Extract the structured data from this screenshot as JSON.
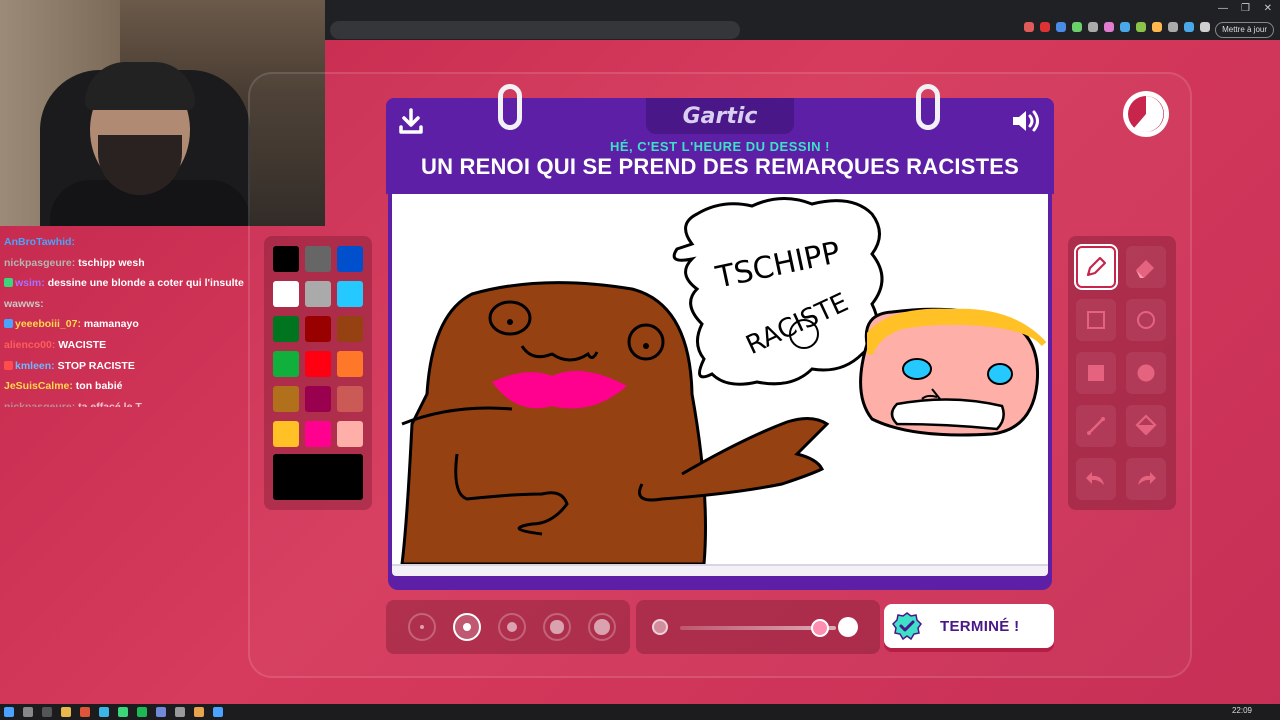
{
  "browser": {
    "update_button": "Mettre à jour",
    "extension_colors": [
      "#e05a5a",
      "#d33",
      "#4a8be8",
      "#6bd06b",
      "#aaa",
      "#e07cd0",
      "#4aa8e8",
      "#8bc34a",
      "#ffb84d",
      "#aaa",
      "#4aa8e8",
      "#cfcfcf"
    ]
  },
  "chat": {
    "messages": [
      {
        "user": "AnBroTawhid:",
        "user_color": "#4aa3ff",
        "msg": "",
        "badge": ""
      },
      {
        "user": "nickpasgeure:",
        "user_color": "#b5b5b5",
        "msg": "tschipp wesh",
        "badge": ""
      },
      {
        "user": "wsim:",
        "user_color": "#a970ff",
        "msg": "dessine une blonde a coter qui l'insulte",
        "badge": "#3bd67a"
      },
      {
        "user": "wawws:",
        "user_color": "#c9c9c9",
        "msg": "",
        "badge": ""
      },
      {
        "user": "yeeeboiii_07:",
        "user_color": "#ffd84d",
        "msg": "mamanayo",
        "badge": "#4aa3ff"
      },
      {
        "user": "alienco00:",
        "user_color": "#ff5d5d",
        "msg": "WACISTE",
        "badge": ""
      },
      {
        "user": "kmleen:",
        "user_color": "#6fb8ff",
        "msg": "STOP RACISTE",
        "badge": "#ff4d4d"
      },
      {
        "user": "JeSuisCalme:",
        "user_color": "#ffd84d",
        "msg": "ton babié",
        "badge": ""
      },
      {
        "user": "nickpasgeure:",
        "user_color": "#b5b5b5",
        "msg": "ta effacé le T",
        "badge": ""
      }
    ]
  },
  "game": {
    "logo": "Gartic",
    "subtitle": "HÉ, C'EST L'HEURE DU DESSIN !",
    "prompt": "UN RENOI QUI SE PREND DES REMARQUES RACISTES",
    "done_label": "TERMINÉ !",
    "selected_color": "#000000",
    "selected_size_index": 1,
    "opacity": 0.9,
    "palette": [
      "#000000",
      "#666666",
      "#0050cd",
      "#ffffff",
      "#aaaaaa",
      "#26c9ff",
      "#017420",
      "#990000",
      "#964112",
      "#11b03c",
      "#ff0013",
      "#ff7829",
      "#b0701c",
      "#99004e",
      "#cb5a57",
      "#ffc126",
      "#ff008f",
      "#feafa8"
    ],
    "tools": [
      {
        "name": "pencil",
        "active": true
      },
      {
        "name": "eraser",
        "active": false
      },
      {
        "name": "rectangle-outline",
        "active": false
      },
      {
        "name": "circle-outline",
        "active": false
      },
      {
        "name": "rectangle-filled",
        "active": false
      },
      {
        "name": "circle-filled",
        "active": false
      },
      {
        "name": "line",
        "active": false
      },
      {
        "name": "fill-bucket",
        "active": false
      },
      {
        "name": "undo",
        "active": false
      },
      {
        "name": "redo",
        "active": false
      }
    ],
    "drawing_text": {
      "bubble1": "TSCHIPP",
      "bubble2": "RACISTE"
    }
  },
  "taskbar": {
    "clock": "22:09"
  }
}
